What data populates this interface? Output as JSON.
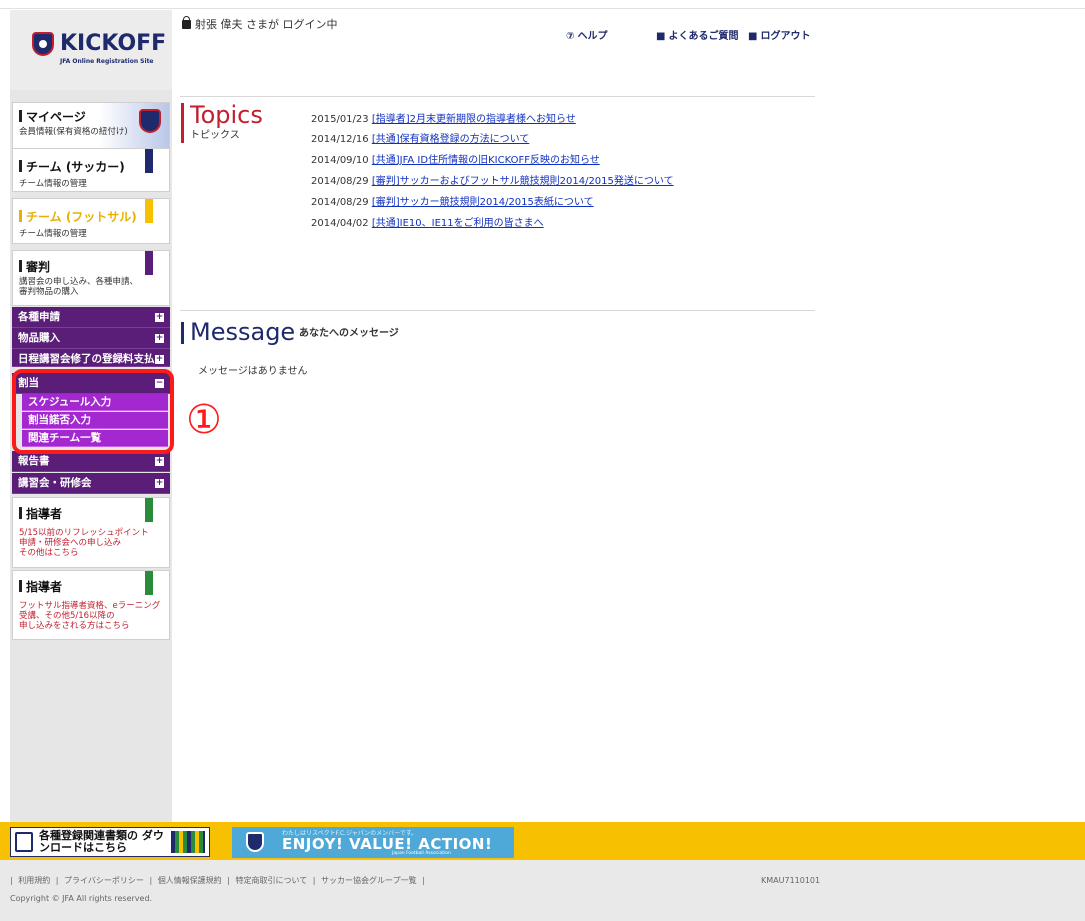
{
  "brand": {
    "logo_text": "KICKOFF",
    "logo_sub": "JFA Online Registration Site"
  },
  "header": {
    "login_status": "射張 偉夫 さまが ログイン中",
    "links": [
      {
        "icon": "help-icon",
        "label": "ヘルプ"
      },
      {
        "icon": "faq-icon",
        "label": "よくあるご質問"
      },
      {
        "icon": "lock-icon",
        "label": "ログアウト"
      }
    ]
  },
  "sidebar": {
    "mypage": {
      "title": "マイページ",
      "sub": "会員情報(保有資格の紐付け)"
    },
    "team_soccer": {
      "title": "チーム (サッカー)",
      "sub": "チーム情報の管理"
    },
    "team_futsal": {
      "title": "チーム (フットサル)",
      "sub": "チーム情報の管理"
    },
    "referee": {
      "title": "審判",
      "sub1": "講習会の申し込み、各種申請、",
      "sub2": "審判物品の購入"
    },
    "menu": [
      {
        "label": "各種申請",
        "state": "+"
      },
      {
        "label": "物品購入",
        "state": "+"
      },
      {
        "label": "日程講習会修了の登録料支払",
        "state": "+"
      },
      {
        "label": "割当",
        "state": "−"
      },
      {
        "label": "報告書",
        "state": "+"
      },
      {
        "label": "講習会・研修会",
        "state": "+"
      }
    ],
    "submenu": [
      "スケジュール入力",
      "割当諾否入力",
      "関連チーム一覧"
    ],
    "coach1": {
      "title": "指導者",
      "sub1": "5/15以前のリフレッシュポイント",
      "sub2": "申請・研修会への申し込み",
      "sub3": "その他はこちら"
    },
    "coach2": {
      "title": "指導者",
      "sub1": "フットサル指導者資格、eラーニング",
      "sub2": "受講、その他5/16以降の",
      "sub3": "申し込みをされる方はこちら"
    }
  },
  "annotation": {
    "marker": "①"
  },
  "topics": {
    "title": "Topics",
    "subtitle": "トピックス",
    "items": [
      {
        "date": "2015/01/23",
        "text": "[指導者]2月末更新期限の指導者様へお知らせ"
      },
      {
        "date": "2014/12/16",
        "text": "[共通]保有資格登録の方法について"
      },
      {
        "date": "2014/09/10",
        "text": "[共通]JFA ID住所情報の旧KICKOFF反映のお知らせ"
      },
      {
        "date": "2014/08/29",
        "text": "[審判]サッカーおよびフットサル競技規則2014/2015発送について"
      },
      {
        "date": "2014/08/29",
        "text": "[審判]サッカー競技規則2014/2015表紙について"
      },
      {
        "date": "2014/04/02",
        "text": "[共通]IE10、IE11をご利用の皆さまへ"
      }
    ]
  },
  "message": {
    "title": "Message",
    "subtitle": "あなたへのメッセージ",
    "empty_text": "メッセージはありません"
  },
  "footer": {
    "download_banner": "各種登録関連書類の ダウンロードはこちら",
    "enjoy_small": "わたしはリスペクトF.C.ジャパンのメンバーです。",
    "enjoy_big": "ENJOY! VALUE! ACTION!",
    "enjoy_assoc": "Japan Football Association",
    "links": [
      "利用規約",
      "プライバシーポリシー",
      "個人情報保護規約",
      "特定商取引について",
      "サッカー協会グループ一覧"
    ],
    "page_code": "KMAU7110101",
    "copyright": "Copyright © JFA All rights reserved."
  },
  "colors": {
    "menu_purple": "#5a1e78",
    "submenu_purple": "#a428d0",
    "topics_red": "#c21f2e",
    "footer_yellow": "#f7c000",
    "annotation_red": "#ff1a1a"
  }
}
